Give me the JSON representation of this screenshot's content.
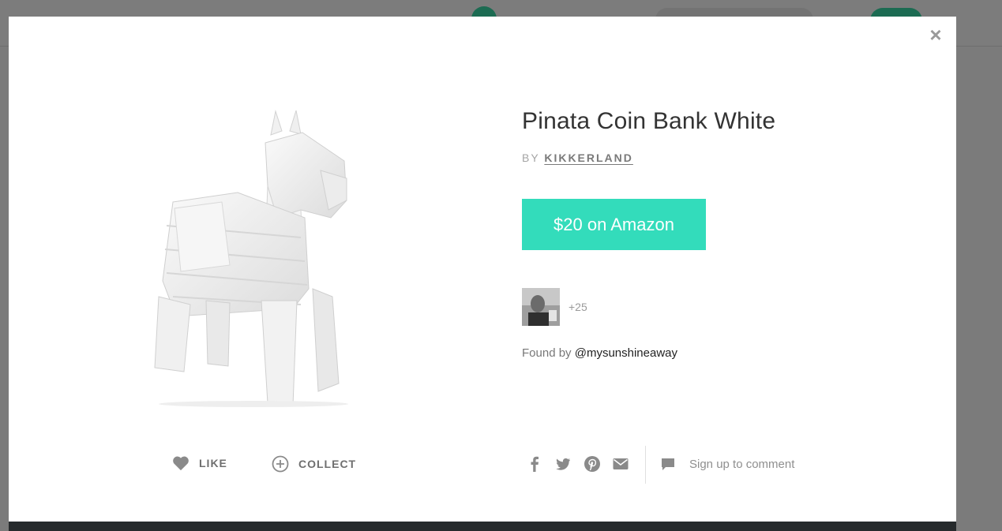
{
  "product": {
    "title": "Pinata Coin Bank White",
    "by_label": "BY",
    "brand": "KIKKERLAND",
    "buy_label": "$20 on Amazon"
  },
  "social": {
    "likes_extra": "+25",
    "found_by_label": "Found by",
    "found_by_user": "@mysunshineaway"
  },
  "actions": {
    "like_label": "LIKE",
    "collect_label": "COLLECT",
    "comment_label": "Sign up to comment"
  },
  "modal": {
    "close_glyph": "×"
  },
  "icons": [
    "heart-icon",
    "plus-circle-icon",
    "facebook-icon",
    "twitter-icon",
    "pinterest-icon",
    "email-icon",
    "comment-icon",
    "close-icon"
  ],
  "colors": {
    "accent": "#33dcbb",
    "overlay": "#7b7b7b"
  }
}
